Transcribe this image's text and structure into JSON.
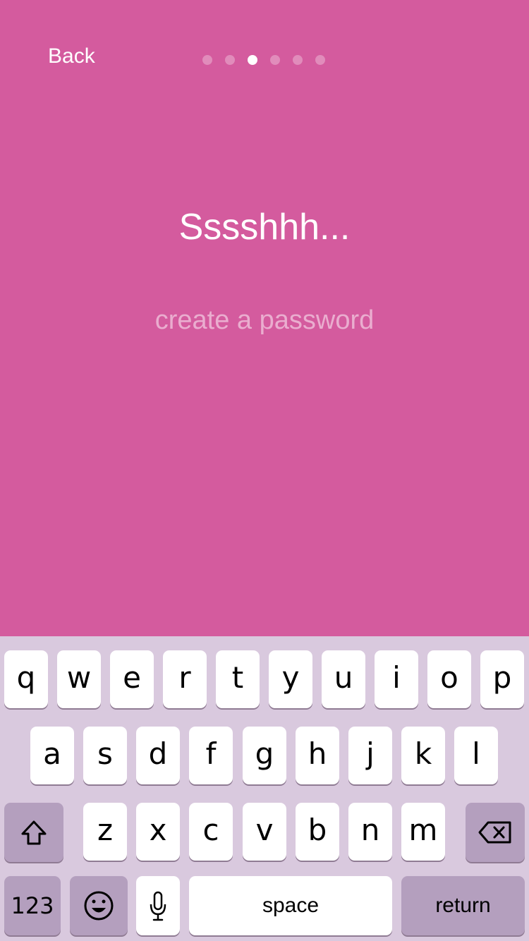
{
  "colors": {
    "background": "#d45b9e",
    "keyboard_background": "#d9c9de",
    "dark_key": "#b49fbe"
  },
  "header": {
    "back_label": "Back",
    "pagination": {
      "total": 6,
      "current": 3
    }
  },
  "main": {
    "title": "Sssshhh...",
    "password_placeholder": "create a password"
  },
  "keyboard": {
    "row1": [
      "q",
      "w",
      "e",
      "r",
      "t",
      "y",
      "u",
      "i",
      "o",
      "p"
    ],
    "row2": [
      "a",
      "s",
      "d",
      "f",
      "g",
      "h",
      "j",
      "k",
      "l"
    ],
    "row3": [
      "z",
      "x",
      "c",
      "v",
      "b",
      "n",
      "m"
    ],
    "shift_icon": "shift-icon",
    "delete_icon": "backspace-icon",
    "numbers_label": "123",
    "emoji_icon": "emoji-icon",
    "mic_icon": "microphone-icon",
    "space_label": "space",
    "return_label": "return"
  }
}
